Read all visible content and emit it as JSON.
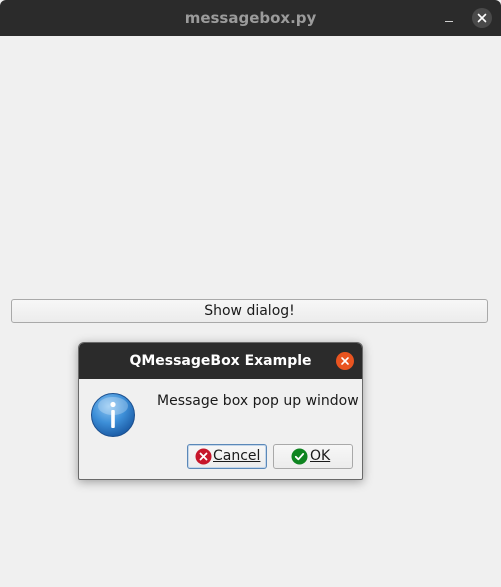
{
  "window": {
    "title": "messagebox.py",
    "icons": {
      "minimize": "minimize-icon",
      "close": "close-icon"
    }
  },
  "main": {
    "show_dialog_label": "Show dialog!"
  },
  "dialog": {
    "title": "QMessageBox Example",
    "message": "Message box pop up window",
    "icon": "information-icon",
    "buttons": {
      "cancel": {
        "label": "Cancel",
        "icon": "cancel-icon"
      },
      "ok": {
        "label": "OK",
        "icon": "check-icon"
      }
    }
  },
  "colors": {
    "titlebar": "#2b2b2b",
    "dialog_close": "#e95420",
    "background": "#f0f0f0"
  }
}
